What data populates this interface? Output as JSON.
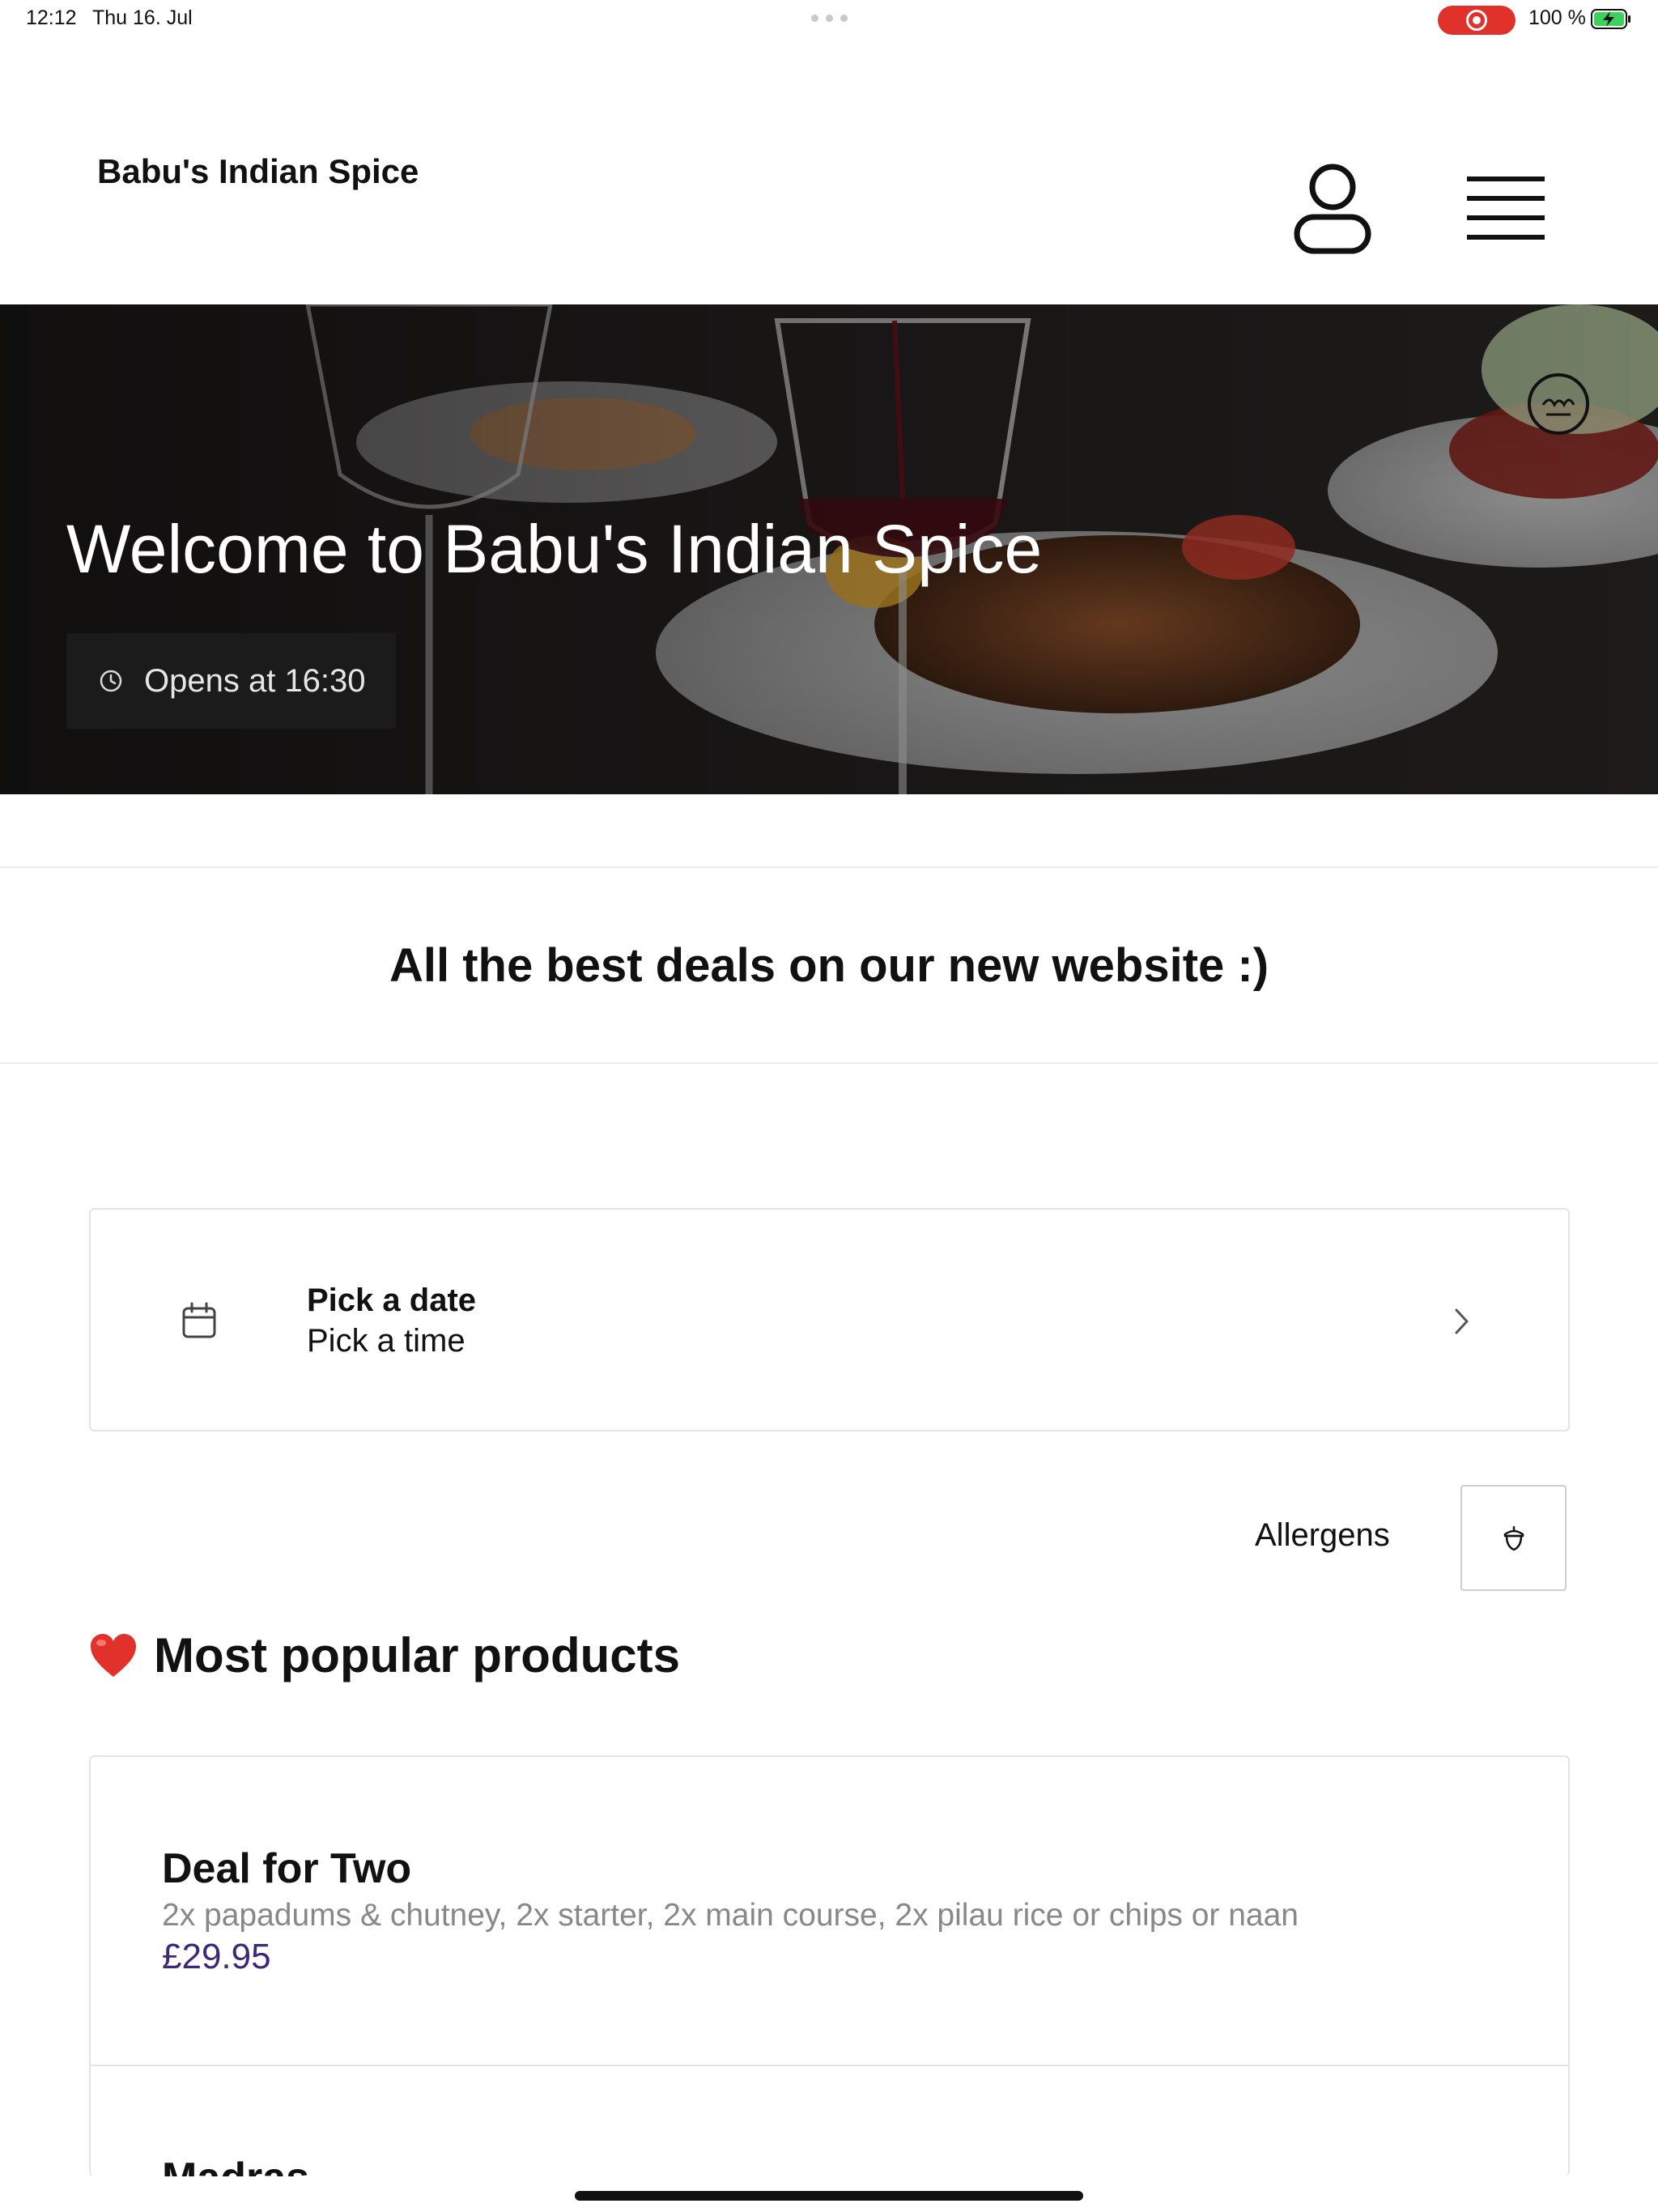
{
  "status_bar": {
    "time": "12:12",
    "date": "Thu 16. Jul",
    "battery_percent": "100 %",
    "recording": true
  },
  "header": {
    "brand": "Babu's Indian Spice",
    "account_icon": "user-icon",
    "menu_icon": "hamburger-menu-icon"
  },
  "hero": {
    "title": "Welcome to Babu's Indian Spice",
    "opening_status": "Opens at 16:30",
    "badge_icon": "halal-logo"
  },
  "announcement": {
    "text": "All the best deals on our new website :)"
  },
  "picker": {
    "date_label": "Pick a date",
    "time_label": "Pick a time",
    "icon": "calendar-icon"
  },
  "allergens": {
    "label": "Allergens",
    "icon": "acorn-icon"
  },
  "popular": {
    "emoji": "heart",
    "title": "Most popular products"
  },
  "products": [
    {
      "name": "Deal for Two",
      "description": "2x papadums & chutney, 2x starter, 2x main course, 2x pilau rice or chips or naan",
      "price": "£29.95"
    },
    {
      "name": "Madras"
    }
  ],
  "colors": {
    "price": "#3b2a78",
    "recording": "#e0322b",
    "battery": "#3bd15a"
  }
}
